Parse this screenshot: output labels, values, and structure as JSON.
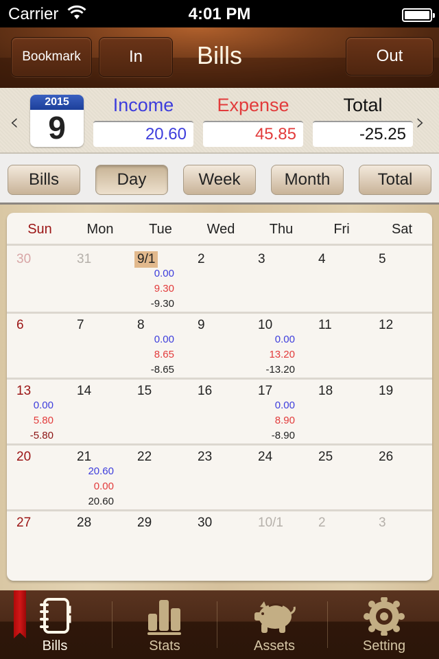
{
  "status_bar": {
    "carrier": "Carrier",
    "time": "4:01 PM",
    "battery_percent": 100
  },
  "navbar": {
    "title": "Bills",
    "buttons": {
      "bookmark": "Bookmark",
      "in": "In",
      "out": "Out"
    }
  },
  "summary": {
    "year": "2015",
    "month": "9",
    "prev_icon": "chevron-left-icon",
    "next_icon": "chevron-right-icon",
    "income_label": "Income",
    "income_value": "20.60",
    "expense_label": "Expense",
    "expense_value": "45.85",
    "total_label": "Total",
    "total_value": "-25.25",
    "colors": {
      "income": "#3d3ddc",
      "expense": "#e23b3b",
      "total": "#111111"
    }
  },
  "segments": {
    "active": "Day",
    "items": [
      "Bills",
      "Day",
      "Week",
      "Month",
      "Total"
    ]
  },
  "calendar": {
    "weekdays": [
      "Sun",
      "Mon",
      "Tue",
      "Wed",
      "Thu",
      "Fri",
      "Sat"
    ],
    "weeks": [
      [
        {
          "label": "30",
          "other": true
        },
        {
          "label": "31",
          "other": true
        },
        {
          "label": "9/1",
          "today": true,
          "income": "0.00",
          "expense": "9.30",
          "total": "-9.30"
        },
        {
          "label": "2"
        },
        {
          "label": "3"
        },
        {
          "label": "4"
        },
        {
          "label": "5"
        }
      ],
      [
        {
          "label": "6"
        },
        {
          "label": "7"
        },
        {
          "label": "8",
          "income": "0.00",
          "expense": "8.65",
          "total": "-8.65"
        },
        {
          "label": "9"
        },
        {
          "label": "10",
          "income": "0.00",
          "expense": "13.20",
          "total": "-13.20"
        },
        {
          "label": "11"
        },
        {
          "label": "12"
        }
      ],
      [
        {
          "label": "13",
          "income": "0.00",
          "expense": "5.80",
          "total": "-5.80",
          "total_red": true
        },
        {
          "label": "14"
        },
        {
          "label": "15"
        },
        {
          "label": "16"
        },
        {
          "label": "17",
          "income": "0.00",
          "expense": "8.90",
          "total": "-8.90"
        },
        {
          "label": "18"
        },
        {
          "label": "19"
        }
      ],
      [
        {
          "label": "20"
        },
        {
          "label": "21",
          "income": "20.60",
          "expense": "0.00",
          "total": "20.60"
        },
        {
          "label": "22"
        },
        {
          "label": "23"
        },
        {
          "label": "24"
        },
        {
          "label": "25"
        },
        {
          "label": "26"
        }
      ],
      [
        {
          "label": "27"
        },
        {
          "label": "28"
        },
        {
          "label": "29"
        },
        {
          "label": "30"
        },
        {
          "label": "10/1",
          "other": true
        },
        {
          "label": "2",
          "other": true
        },
        {
          "label": "3",
          "other": true
        }
      ]
    ]
  },
  "tabbar": {
    "active": "Bills",
    "items": [
      {
        "label": "Bills",
        "icon": "notebook-icon"
      },
      {
        "label": "Stats",
        "icon": "bar-chart-icon"
      },
      {
        "label": "Assets",
        "icon": "piggy-bank-icon"
      },
      {
        "label": "Setting",
        "icon": "gear-icon"
      }
    ]
  }
}
